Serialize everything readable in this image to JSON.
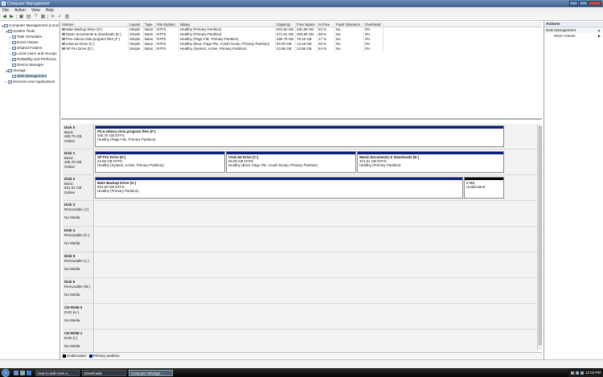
{
  "window": {
    "title": "Computer Management"
  },
  "menu": [
    "File",
    "Action",
    "View",
    "Help"
  ],
  "tree": [
    {
      "label": "Computer Management (Local",
      "level": 0,
      "expanded": true
    },
    {
      "label": "System Tools",
      "level": 1,
      "expanded": true
    },
    {
      "label": "Task Scheduler",
      "level": 2,
      "expanded": false
    },
    {
      "label": "Event Viewer",
      "level": 2,
      "expanded": false
    },
    {
      "label": "Shared Folders",
      "level": 2,
      "expanded": false
    },
    {
      "label": "Local Users and Groups",
      "level": 2,
      "expanded": false
    },
    {
      "label": "Reliability and Performa",
      "level": 2,
      "expanded": false
    },
    {
      "label": "Device Manager",
      "level": 2,
      "expanded": null
    },
    {
      "label": "Storage",
      "level": 1,
      "expanded": true
    },
    {
      "label": "Disk Management",
      "level": 2,
      "expanded": null,
      "selected": true
    },
    {
      "label": "Services and Applications",
      "level": 1,
      "expanded": false
    }
  ],
  "volume_table": {
    "headers": [
      "Volume",
      "Layout",
      "Type",
      "File System",
      "Status",
      "Capacity",
      "Free Space",
      "% Free",
      "Fault Tolerance",
      "Overhead"
    ],
    "rows": [
      [
        "Main Backup Drive (G:)",
        "Simple",
        "Basic",
        "NTFS",
        "Healthy (Primary Partition)",
        "931.50 GB",
        "481.86 GB",
        "52 %",
        "No",
        "0%"
      ],
      [
        "Music.documents & downloads (E:)",
        "Simple",
        "Basic",
        "NTFS",
        "Healthy (Primary Partition)",
        "371.81 GB",
        "253.86 GB",
        "68 %",
        "No",
        "0%"
      ],
      [
        "Pics.videos.vista program files (F:)",
        "Simple",
        "Basic",
        "NTFS",
        "Healthy (Page File, Primary Partition)",
        "465.76 GB",
        "79.18 GB",
        "17 %",
        "No",
        "0%"
      ],
      [
        "Vista 64 Drive (C:)",
        "Simple",
        "Basic",
        "NTFS",
        "Healthy (Boot, Page File, Crash Dump, Primary Partition)",
        "50.00 GB",
        "13.19 GB",
        "26 %",
        "No",
        "0%"
      ],
      [
        "XP Pro Drive (D:)",
        "Simple",
        "Basic",
        "NTFS",
        "Healthy (System, Active, Primary Partition)",
        "43.95 GB",
        "23.68 GB",
        "54 %",
        "No",
        "0%"
      ]
    ]
  },
  "disks": [
    {
      "name": "Disk 0",
      "line1": "Basic",
      "line2": "465.76 GB",
      "line3": "Online",
      "partitions": [
        {
          "name": "Pics.videos.vista program files  (F:)",
          "size": "465.76 GB NTFS",
          "status": "Healthy (Page File, Primary Partition)",
          "fraction": 1.0,
          "unallocated": false
        }
      ]
    },
    {
      "name": "Disk 1",
      "line1": "Basic",
      "line2": "465.76 GB",
      "line3": "Online",
      "partitions": [
        {
          "name": "XP Pro Drive  (D:)",
          "size": "43.95 GB NTFS",
          "status": "Healthy (System, Active, Primary Partition)",
          "fraction": 0.32,
          "unallocated": false
        },
        {
          "name": "Vista 64 Drive  (C:)",
          "size": "50.00 GB NTFS",
          "status": "Healthy (Boot, Page File, Crash Dump, Primary Partition)",
          "fraction": 0.32,
          "unallocated": false
        },
        {
          "name": "Music.documents & downloads  (E:)",
          "size": "371.81 GB NTFS",
          "status": "Healthy (Primary Partition)",
          "fraction": 0.36,
          "unallocated": false
        }
      ]
    },
    {
      "name": "Disk 2",
      "line1": "Basic",
      "line2": "931.51 GB",
      "line3": "Online",
      "partitions": [
        {
          "name": "Main Backup Drive  (G:)",
          "size": "931.50 GB NTFS",
          "status": "Healthy (Primary Partition)",
          "fraction": 0.9,
          "unallocated": false
        },
        {
          "name": "",
          "size": "9 MB",
          "status": "Unallocated",
          "fraction": 0.1,
          "unallocated": true
        }
      ]
    },
    {
      "name": "Disk 3",
      "line1": "Removable (J:)",
      "line2": "",
      "line3": "No Media",
      "partitions": []
    },
    {
      "name": "Disk 4",
      "line1": "Removable (K:)",
      "line2": "",
      "line3": "No Media",
      "partitions": []
    },
    {
      "name": "Disk 5",
      "line1": "Removable (L:)",
      "line2": "",
      "line3": "No Media",
      "partitions": []
    },
    {
      "name": "Disk 6",
      "line1": "Removable (M:)",
      "line2": "",
      "line3": "No Media",
      "partitions": []
    },
    {
      "name": "CD-ROM 0",
      "line1": "DVD (H:)",
      "line2": "",
      "line3": "No Media",
      "partitions": []
    },
    {
      "name": "CD-ROM 1",
      "line1": "DVD (I:)",
      "line2": "",
      "line3": "No Media",
      "partitions": []
    }
  ],
  "legend": [
    {
      "label": "Unallocated",
      "color": "#000000"
    },
    {
      "label": "Primary partition",
      "color": "#0a1e86"
    }
  ],
  "actions": {
    "title": "Actions",
    "group": "Disk Management",
    "items": [
      "More Actions"
    ]
  },
  "taskbar": {
    "buttons": [
      "How to add more s...",
      "Downloads",
      "Computer Manage..."
    ],
    "active_index": 2,
    "clock": "12:02 PM"
  }
}
